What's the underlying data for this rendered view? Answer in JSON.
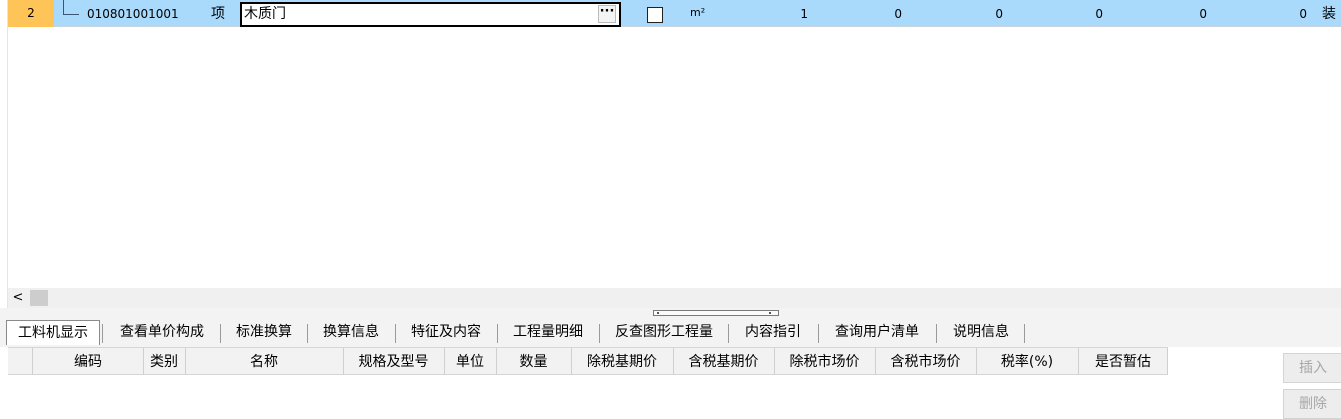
{
  "main_row": {
    "index": "2",
    "code": "010801001001",
    "type": "项",
    "name": "木质门",
    "name_button": "···",
    "unit": "m²",
    "values": [
      "1",
      "0",
      "0",
      "0",
      "0",
      "0"
    ],
    "trailing": "装"
  },
  "scroll": {
    "left_arrow": "<"
  },
  "tabs": [
    {
      "label": "工料机显示",
      "active": true
    },
    {
      "label": "查看单价构成"
    },
    {
      "label": "标准换算"
    },
    {
      "label": "换算信息"
    },
    {
      "label": "特征及内容"
    },
    {
      "label": "工程量明细"
    },
    {
      "label": "反查图形工程量"
    },
    {
      "label": "内容指引"
    },
    {
      "label": "查询用户清单"
    },
    {
      "label": "说明信息"
    }
  ],
  "subtable": {
    "columns": [
      "编码",
      "类别",
      "名称",
      "规格及型号",
      "单位",
      "数量",
      "除税基期价",
      "含税基期价",
      "除税市场价",
      "含税市场价",
      "税率(%)",
      "是否暂估"
    ]
  },
  "side_buttons": {
    "insert": "插入",
    "delete": "删除"
  },
  "colors": {
    "row_highlight": "#a9d9fb",
    "row_number_bg": "#ffc457",
    "tab_bar": "#f3f3f3"
  }
}
